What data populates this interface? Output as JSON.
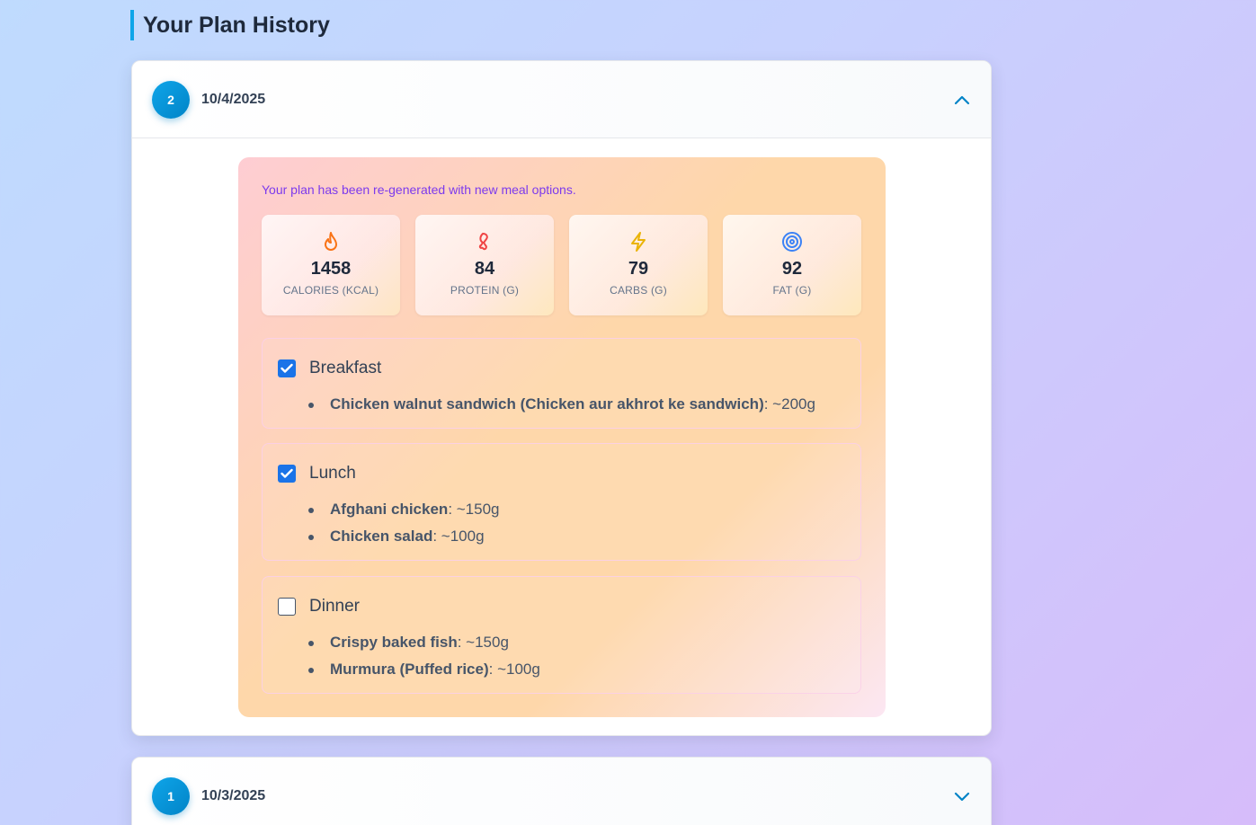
{
  "page": {
    "title": "Your Plan History"
  },
  "plans": [
    {
      "number": "2",
      "date": "10/4/2025",
      "expanded": true,
      "message": "Your plan has been re-generated with new meal options.",
      "stats": [
        {
          "icon": "flame-icon",
          "value": "1458",
          "label": "CALORIES (KCAL)"
        },
        {
          "icon": "drumstick-icon",
          "value": "84",
          "label": "PROTEIN (G)"
        },
        {
          "icon": "lightning-icon",
          "value": "79",
          "label": "CARBS (G)"
        },
        {
          "icon": "target-icon",
          "value": "92",
          "label": "FAT (G)"
        }
      ],
      "meals": [
        {
          "name": "Breakfast",
          "checked": true,
          "items": [
            {
              "name": "Chicken walnut sandwich (Chicken aur akhrot ke sandwich)",
              "qty": ": ~200g"
            }
          ]
        },
        {
          "name": "Lunch",
          "checked": true,
          "items": [
            {
              "name": "Afghani chicken",
              "qty": ": ~150g"
            },
            {
              "name": "Chicken salad",
              "qty": ": ~100g"
            }
          ]
        },
        {
          "name": "Dinner",
          "checked": false,
          "items": [
            {
              "name": "Crispy baked fish",
              "qty": ": ~150g"
            },
            {
              "name": "Murmura (Puffed rice)",
              "qty": ": ~100g"
            }
          ]
        }
      ]
    },
    {
      "number": "1",
      "date": "10/3/2025",
      "expanded": false
    }
  ],
  "colors": {
    "accent": "#0ea5e9",
    "checkbox": "#1a73e8",
    "message": "#7c3aed"
  }
}
